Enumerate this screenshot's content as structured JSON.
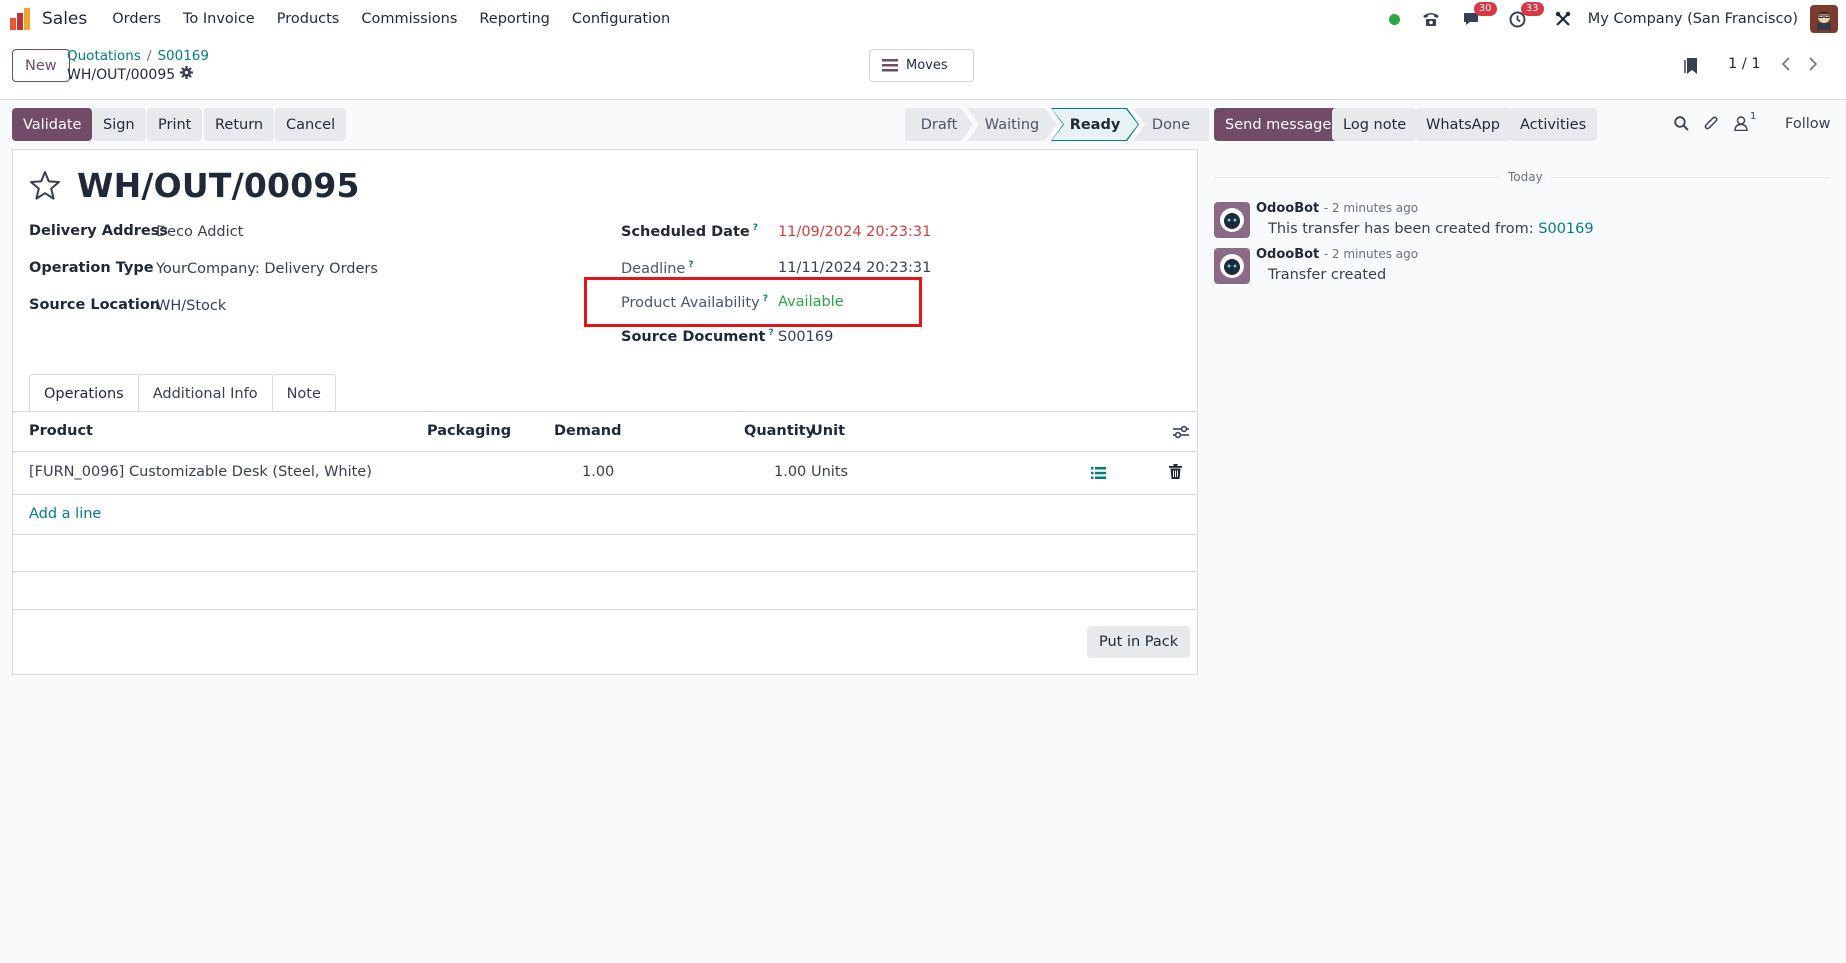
{
  "navbar": {
    "app_name": "Sales",
    "menu": [
      "Orders",
      "To Invoice",
      "Products",
      "Commissions",
      "Reporting",
      "Configuration"
    ],
    "messages_badge": "30",
    "activities_badge": "33",
    "company": "My Company (San Francisco)",
    "status_color": "#28a745"
  },
  "control_panel": {
    "new_label": "New",
    "breadcrumb": [
      "Quotations",
      "S00169"
    ],
    "record_name": "WH/OUT/00095",
    "moves_label": "Moves",
    "pager": "1 / 1"
  },
  "statusbar": {
    "actions": [
      "Validate",
      "Sign",
      "Print",
      "Return",
      "Cancel"
    ],
    "stages": [
      "Draft",
      "Waiting",
      "Ready",
      "Done"
    ],
    "active_stage": "Ready"
  },
  "form": {
    "title": "WH/OUT/00095",
    "left_fields": [
      {
        "label": "Delivery Address",
        "value": "Deco Addict"
      },
      {
        "label": "Operation Type",
        "value": "YourCompany: Delivery Orders"
      },
      {
        "label": "Source Location",
        "value": "WH/Stock"
      }
    ],
    "right_fields": [
      {
        "label": "Scheduled Date",
        "help": "?",
        "value": "11/09/2024 20:23:31"
      },
      {
        "label": "Deadline",
        "help": "?",
        "value": "11/11/2024 20:23:31"
      },
      {
        "label": "Product Availability",
        "help": "?",
        "value": "Available"
      },
      {
        "label": "Source Document",
        "help": "?",
        "value": "S00169"
      }
    ],
    "tabs": [
      "Operations",
      "Additional Info",
      "Note"
    ],
    "table": {
      "headers": [
        "Product",
        "Packaging",
        "Demand",
        "Quantity",
        "Unit"
      ],
      "rows": [
        {
          "product": "[FURN_0096] Customizable Desk (Steel, White)",
          "packaging": "",
          "demand": "1.00",
          "quantity": "1.00",
          "unit": "Units"
        }
      ]
    },
    "add_line": "Add a line",
    "put_in_pack": "Put in Pack"
  },
  "chatter": {
    "buttons": [
      "Send message",
      "Log note",
      "WhatsApp",
      "Activities"
    ],
    "followers_count": "1",
    "follow_label": "Follow",
    "date_separator": "Today",
    "messages": [
      {
        "author": "OdooBot",
        "time": "- 2 minutes ago",
        "body": "This transfer has been created from: ",
        "link": "S00169"
      },
      {
        "author": "OdooBot",
        "time": "- 2 minutes ago",
        "body": "Transfer created",
        "link": ""
      }
    ]
  },
  "colors": {
    "brand": "#714b67",
    "link": "#017e84",
    "danger": "#d23f3a",
    "success": "#28a745",
    "highlight": "#e3151a"
  }
}
